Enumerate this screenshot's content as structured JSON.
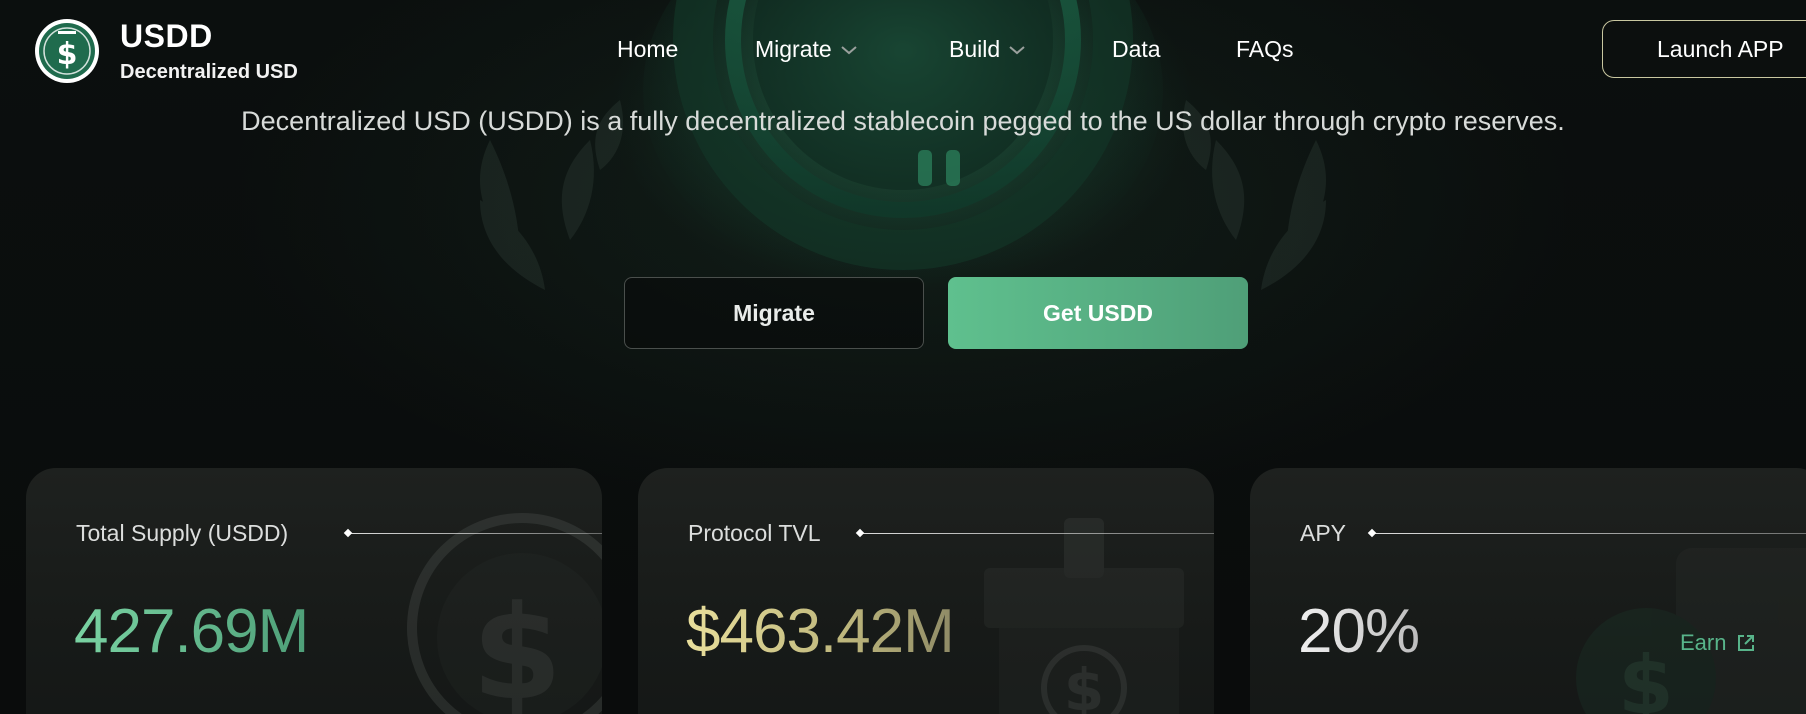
{
  "header": {
    "brand_name": "USDD",
    "brand_sub": "Decentralized USD",
    "nav": [
      {
        "label": "Home",
        "has_dropdown": false
      },
      {
        "label": "Migrate",
        "has_dropdown": true
      },
      {
        "label": "Build",
        "has_dropdown": true
      },
      {
        "label": "Data",
        "has_dropdown": false
      },
      {
        "label": "FAQs",
        "has_dropdown": false
      }
    ],
    "launch_label": "Launch APP"
  },
  "hero": {
    "tagline": "Decentralized USD (USDD) is a fully decentralized stablecoin pegged to the US dollar through crypto reserves.",
    "migrate_label": "Migrate",
    "get_label": "Get USDD"
  },
  "stats": [
    {
      "label": "Total Supply (USDD)",
      "value": "427.69M",
      "style": "green"
    },
    {
      "label": "Protocol TVL",
      "value": "$463.42M",
      "style": "gold"
    },
    {
      "label": "APY",
      "value": "20%",
      "style": "gray",
      "link_label": "Earn"
    }
  ],
  "colors": {
    "accent_green": "#5fc08e",
    "brand_dark_green": "#1f6b4d",
    "gold": "#e9df9c",
    "background": "#0a0d0c",
    "card": "#1b1e1c"
  },
  "icons": {
    "logo": "usdd-dollar-coin-icon",
    "dropdown": "chevron-down-icon",
    "external": "external-link-icon"
  }
}
